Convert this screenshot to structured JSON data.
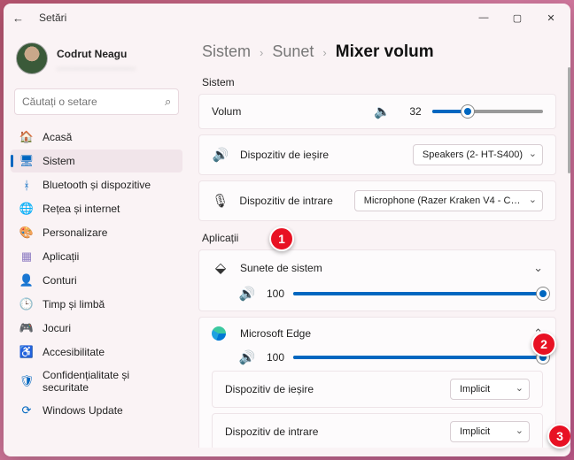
{
  "window": {
    "title": "Setări"
  },
  "profile": {
    "name": "Codrut Neagu",
    "sub": "________________"
  },
  "search": {
    "placeholder": "Căutați o setare"
  },
  "nav": {
    "items": [
      {
        "label": "Acasă",
        "icon": "🏠",
        "cls": "ic-home"
      },
      {
        "label": "Sistem",
        "icon": "🖥",
        "cls": "ic-system",
        "active": true
      },
      {
        "label": "Bluetooth și dispozitive",
        "icon": "ᚼ",
        "cls": "ic-bt"
      },
      {
        "label": "Rețea și internet",
        "icon": "🌐",
        "cls": "ic-net"
      },
      {
        "label": "Personalizare",
        "icon": "🎨",
        "cls": "ic-pers"
      },
      {
        "label": "Aplicații",
        "icon": "▦",
        "cls": "ic-apps"
      },
      {
        "label": "Conturi",
        "icon": "👤",
        "cls": "ic-acc"
      },
      {
        "label": "Timp și limbă",
        "icon": "🕒",
        "cls": "ic-time"
      },
      {
        "label": "Jocuri",
        "icon": "🎮",
        "cls": "ic-game"
      },
      {
        "label": "Accesibilitate",
        "icon": "♿",
        "cls": "ic-access"
      },
      {
        "label": "Confidențialitate și securitate",
        "icon": "🛡",
        "cls": "ic-priv"
      },
      {
        "label": "Windows Update",
        "icon": "⟳",
        "cls": "ic-wu"
      }
    ]
  },
  "breadcrumb": {
    "a": "Sistem",
    "b": "Sunet",
    "c": "Mixer volum"
  },
  "system": {
    "label": "Sistem",
    "volume_label": "Volum",
    "volume_value": "32",
    "volume_pct": 32,
    "out_label": "Dispozitiv de ieșire",
    "out_value": "Speakers (2- HT-S400)",
    "in_label": "Dispozitiv de intrare",
    "in_value": "Microphone (Razer Kraken V4 - Chat)"
  },
  "apps": {
    "label": "Aplicații",
    "items": [
      {
        "name": "Sunete de sistem",
        "vol": "100",
        "pct": 100,
        "icon": "speaker",
        "expanded": false
      },
      {
        "name": "Microsoft Edge",
        "vol": "100",
        "pct": 100,
        "icon": "edge",
        "expanded": true,
        "out_label": "Dispozitiv de ieșire",
        "out_value": "Implicit",
        "in_label": "Dispozitiv de intrare",
        "in_value": "Implicit"
      }
    ]
  },
  "badges": {
    "1": "1",
    "2": "2",
    "3": "3"
  }
}
